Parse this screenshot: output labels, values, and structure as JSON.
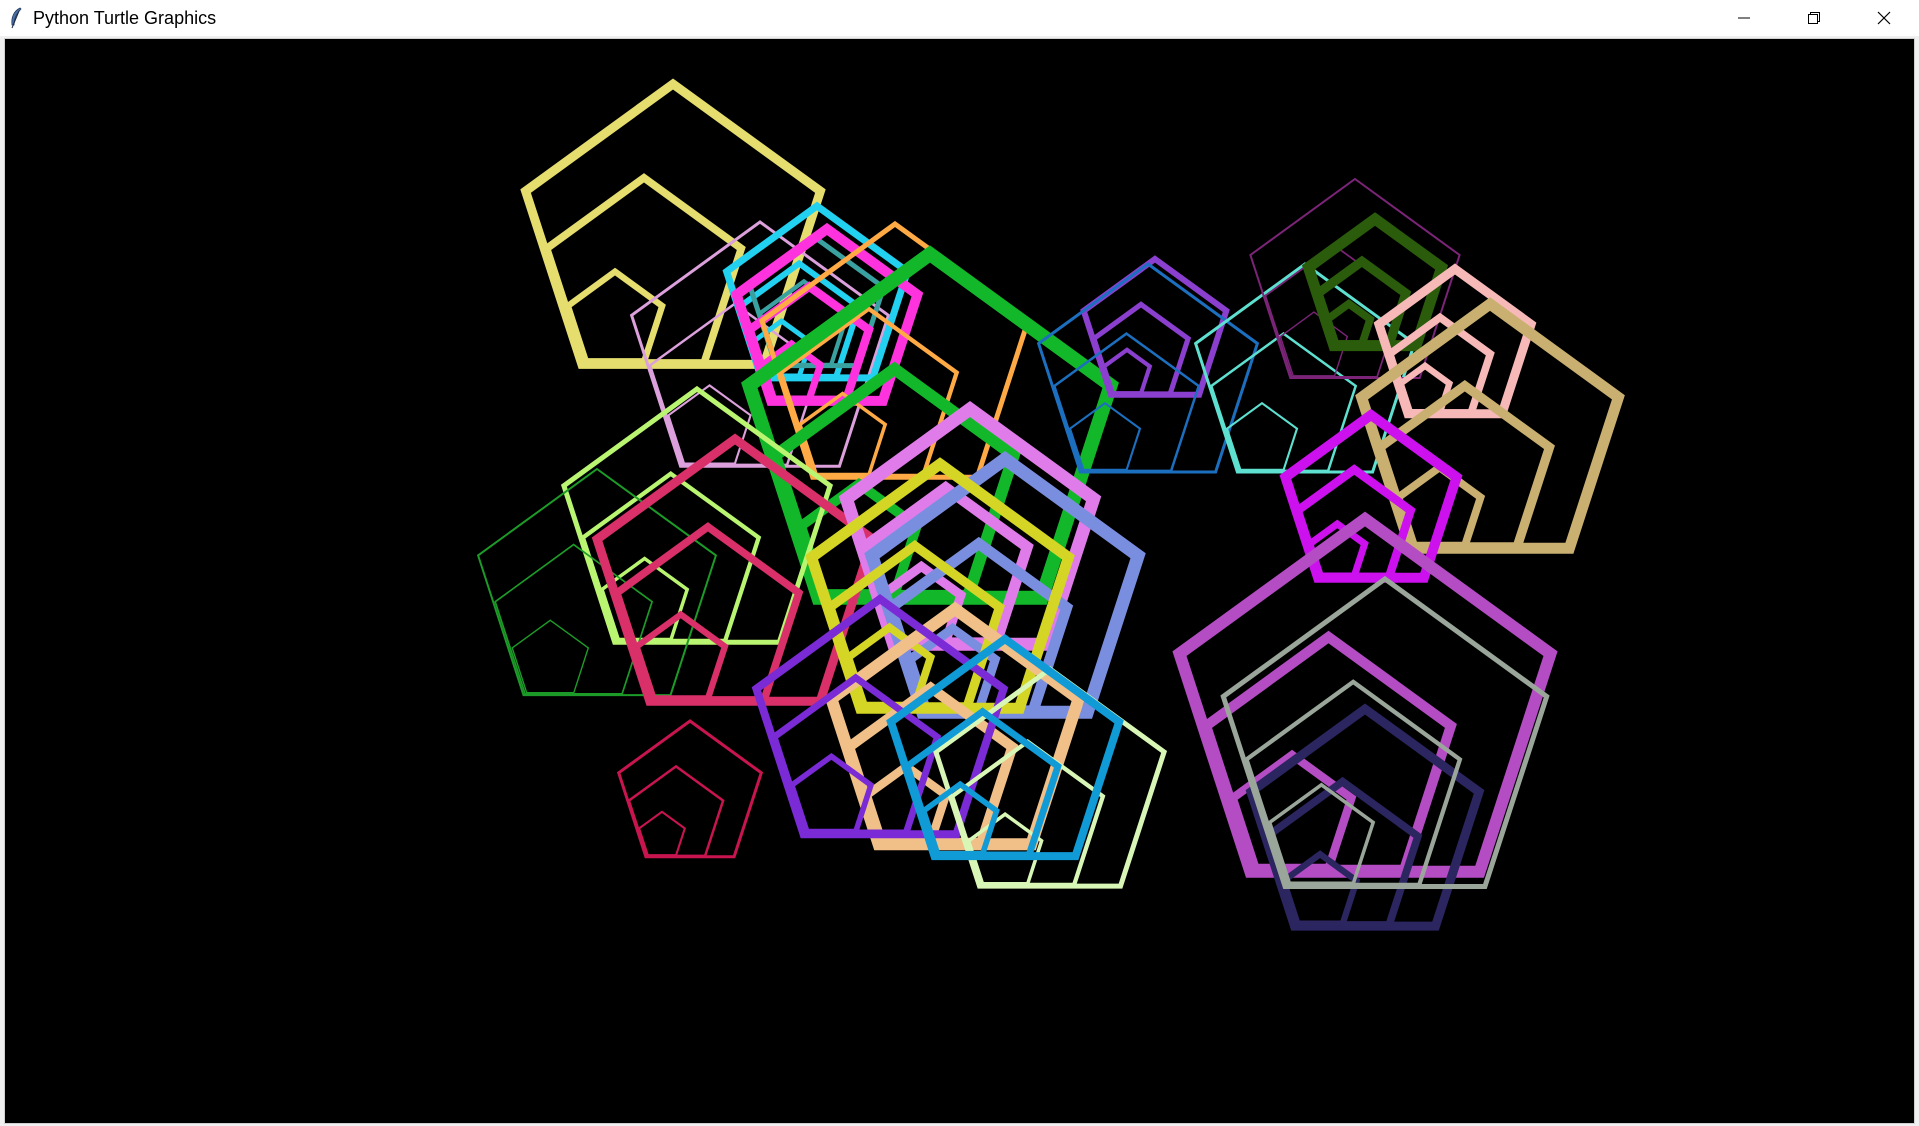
{
  "window": {
    "title": "Python Turtle Graphics",
    "icon": "feather-icon"
  },
  "controls": {
    "minimize_icon": "minimize-icon",
    "restore_icon": "restore-icon",
    "close_icon": "close-icon"
  },
  "canvas": {
    "background": "#000000",
    "shape": "pentagon",
    "pentagon_groups": [
      {
        "color": "#e5dd6e",
        "count": 3
      },
      {
        "color": "#dca0dc",
        "count": 3
      },
      {
        "color": "#22d0f0",
        "count": 3
      },
      {
        "color": "#3aa1a1",
        "count": 2
      },
      {
        "color": "#ff33dd",
        "count": 3
      },
      {
        "color": "#ffaa44",
        "count": 3
      },
      {
        "color": "#13b82a",
        "count": 3
      },
      {
        "color": "#b9f571",
        "count": 3
      },
      {
        "color": "#1d9b28",
        "count": 3
      },
      {
        "color": "#d9306a",
        "count": 3
      },
      {
        "color": "#e07ce9",
        "count": 3
      },
      {
        "color": "#7a8ee0",
        "count": 3
      },
      {
        "color": "#d4d524",
        "count": 3
      },
      {
        "color": "#f0c088",
        "count": 3
      },
      {
        "color": "#7a2bd6",
        "count": 3
      },
      {
        "color": "#d8f7b7",
        "count": 3
      },
      {
        "color": "#109ad6",
        "count": 3
      },
      {
        "color": "#c8154f",
        "count": 3
      },
      {
        "color": "#8b3fcf",
        "count": 3
      },
      {
        "color": "#1c6fbf",
        "count": 3
      },
      {
        "color": "#5ee0d0",
        "count": 3
      },
      {
        "color": "#7b2478",
        "count": 3
      },
      {
        "color": "#2a5c0c",
        "count": 3
      },
      {
        "color": "#f7b8b8",
        "count": 3
      },
      {
        "color": "#c9b070",
        "count": 3
      },
      {
        "color": "#cc11ee",
        "count": 3
      },
      {
        "color": "#b44cc4",
        "count": 3
      },
      {
        "color": "#2b2560",
        "count": 3
      },
      {
        "color": "#9aa69a",
        "count": 3
      }
    ]
  }
}
